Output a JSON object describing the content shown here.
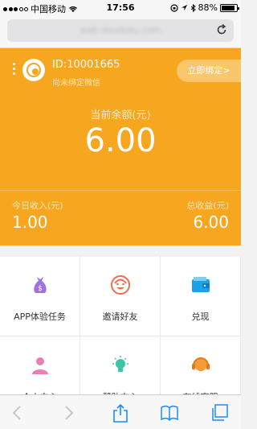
{
  "status_bar": {
    "carrier": "中国移动",
    "time": "17:56",
    "battery": "88%",
    "battery_level": 0.88
  },
  "browser": {
    "url": "wab.douduku.com"
  },
  "account": {
    "user_id": "ID:10001665",
    "wechat_status": "尚未绑定微信",
    "bind_button": "立即绑定>",
    "balance_label": "当前余额(元)",
    "balance_value": "6.00",
    "today_income_label": "今日收入(元)",
    "today_income_value": "1.00",
    "total_income_label": "总收益(元)",
    "total_income_value": "6.00"
  },
  "menu": [
    {
      "label": "APP体验任务",
      "icon": "money-bag-icon"
    },
    {
      "label": "邀请好友",
      "icon": "smiley-face-icon"
    },
    {
      "label": "兑现",
      "icon": "wallet-icon"
    },
    {
      "label": "个人中心",
      "icon": "person-icon"
    },
    {
      "label": "帮助中心",
      "icon": "lightbulb-icon"
    },
    {
      "label": "在线客服",
      "icon": "headset-icon"
    }
  ],
  "colors": {
    "brand_orange": "#f7a620",
    "bind_button": "#f9c66b"
  }
}
